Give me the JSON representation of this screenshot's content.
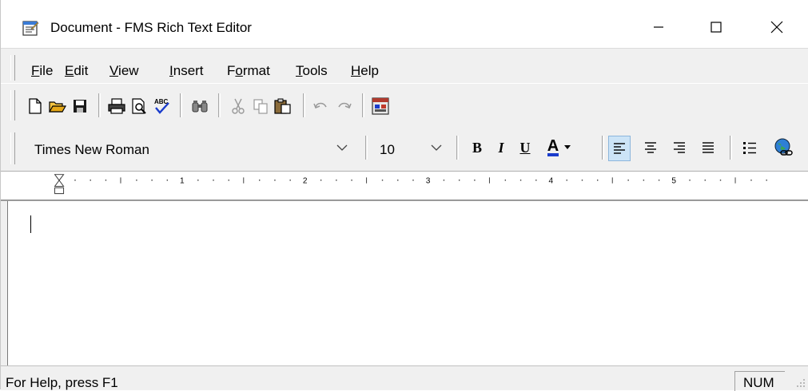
{
  "window": {
    "title": "Document - FMS Rich Text Editor",
    "controls": {
      "minimize": "minimize",
      "maximize": "maximize",
      "close": "close"
    }
  },
  "menu": [
    {
      "pre": "",
      "key": "F",
      "post": "ile"
    },
    {
      "pre": "",
      "key": "E",
      "post": "dit"
    },
    {
      "pre": "",
      "key": "V",
      "post": "iew"
    },
    {
      "pre": "",
      "key": "I",
      "post": "nsert"
    },
    {
      "pre": "F",
      "key": "o",
      "post": "rmat"
    },
    {
      "pre": "",
      "key": "T",
      "post": "ools"
    },
    {
      "pre": "",
      "key": "H",
      "post": "elp"
    }
  ],
  "toolbar": {
    "icons": [
      "new-document-icon",
      "open-folder-icon",
      "save-disk-icon",
      "print-icon",
      "print-preview-icon",
      "spell-check-icon",
      "find-binoculars-icon",
      "cut-scissors-icon",
      "copy-icon",
      "paste-icon",
      "undo-icon",
      "redo-icon",
      "insert-date-time-icon"
    ],
    "spell_check_text": "ABC"
  },
  "format": {
    "font_name": "Times New Roman",
    "font_size": "10",
    "bold": "B",
    "italic": "I",
    "underline": "U",
    "font_color_letter": "A",
    "font_color": "#1a3ccc"
  },
  "ruler": {
    "numbers": [
      "1",
      "2",
      "3",
      "4",
      "5"
    ]
  },
  "editor": {
    "content": ""
  },
  "status": {
    "help": "For Help, press F1",
    "num": "NUM"
  }
}
